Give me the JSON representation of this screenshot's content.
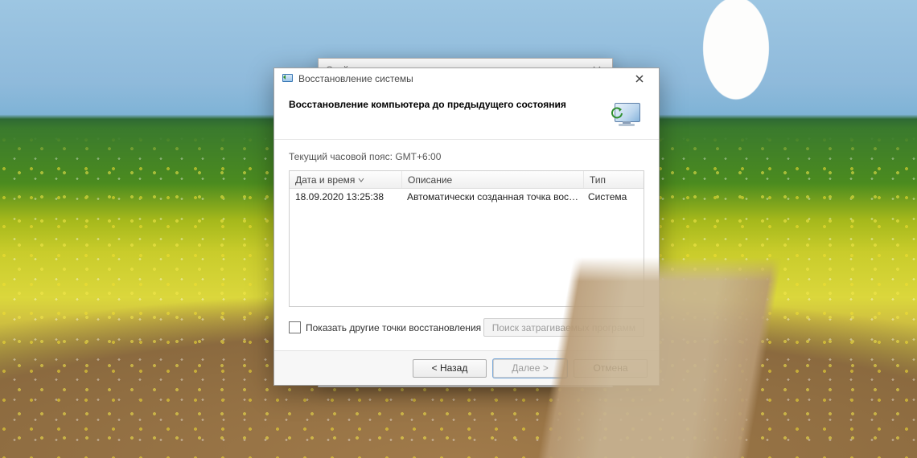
{
  "bg_window": {
    "title": "Свойства системы"
  },
  "dialog": {
    "title": "Восстановление системы",
    "heading": "Восстановление компьютера до предыдущего состояния",
    "timezone": "Текущий часовой пояс: GMT+6:00",
    "columns": {
      "datetime": "Дата и время",
      "desc": "Описание",
      "type": "Тип"
    },
    "rows": [
      {
        "datetime": "18.09.2020 13:25:38",
        "desc": "Автоматически созданная точка восстановле...",
        "type": "Система"
      }
    ],
    "show_other_label": "Показать другие точки восстановления",
    "scan_button": "Поиск затрагиваемых программ",
    "buttons": {
      "back": "< Назад",
      "next": "Далее >",
      "cancel": "Отмена"
    }
  }
}
